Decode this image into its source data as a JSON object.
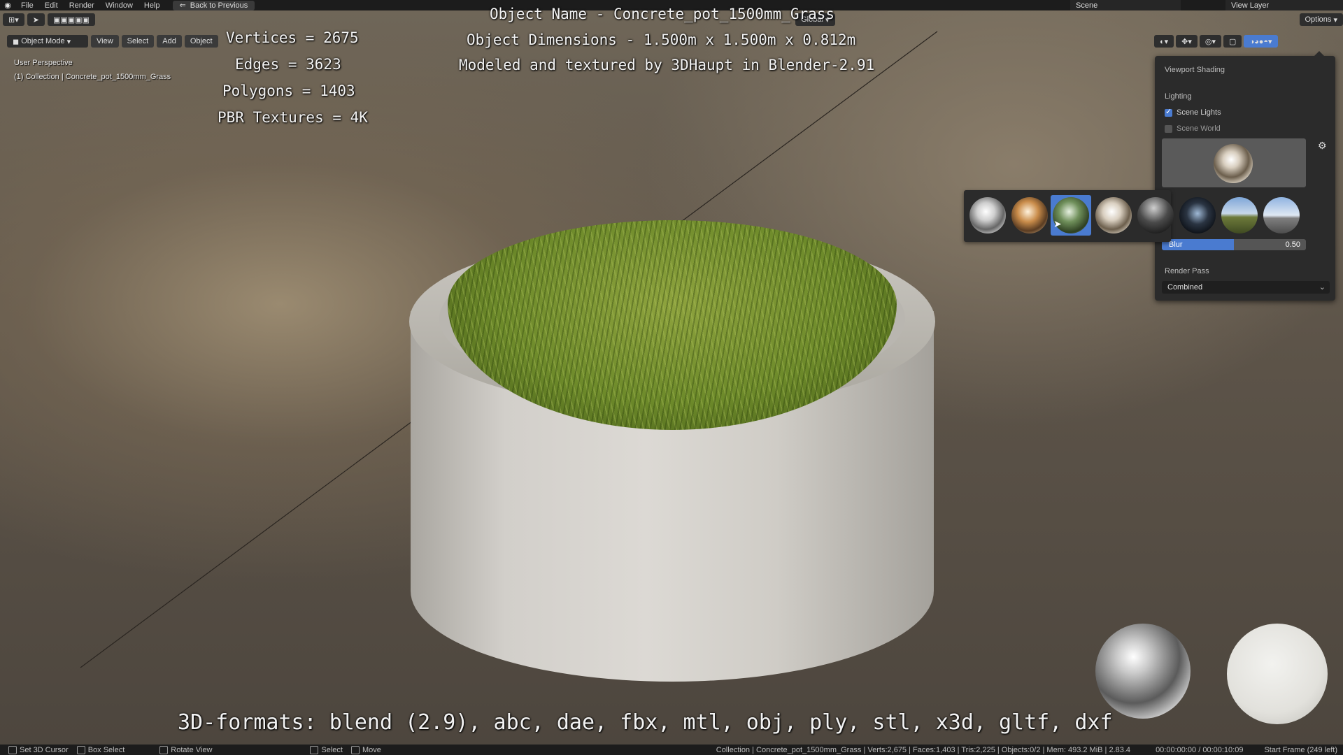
{
  "topbar": {
    "menus": [
      "File",
      "Edit",
      "Render",
      "Window",
      "Help"
    ],
    "back_button": "Back to Previous",
    "scene": "Scene",
    "view_layer": "View Layer"
  },
  "header": {
    "mode": "Object Mode",
    "menus": [
      "View",
      "Select",
      "Add",
      "Object"
    ],
    "orientation": "Global",
    "options": "Options"
  },
  "viewport": {
    "perspective": "User Perspective",
    "collection": "(1) Collection | Concrete_pot_1500mm_Grass",
    "stats": [
      "Vertices = 2675",
      "Edges = 3623",
      "Polygons = 1403",
      "PBR Textures = 4K"
    ],
    "title_lines": [
      "Object Name - Concrete_pot_1500mm_Grass",
      "Object Dimensions -  1.500m x 1.500m x 0.812m",
      "Modeled and textured by 3DHaupt in Blender-2.91"
    ],
    "formats": "3D-formats: blend (2.9), abc, dae, fbx, mtl, obj, ply, stl, x3d, gltf, dxf"
  },
  "shading_panel": {
    "title": "Viewport Shading",
    "lighting_label": "Lighting",
    "scene_lights": "Scene Lights",
    "scene_lights_checked": true,
    "scene_world": "Scene World",
    "scene_world_checked": false,
    "blur_label": "Blur",
    "blur_value": "0.50",
    "blur_fraction": 0.5,
    "render_pass_label": "Render Pass",
    "render_pass_value": "Combined"
  },
  "hdri_picker": {
    "items": [
      "hdri-1",
      "hdri-2",
      "hdri-3",
      "hdri-4",
      "hdri-5",
      "hdri-6",
      "hdri-7",
      "hdri-8"
    ],
    "selected_index": 2
  },
  "statusbar": {
    "left": [
      "Set 3D Cursor",
      "Box Select",
      "Rotate View",
      "Select",
      "Move"
    ],
    "info": "Collection | Concrete_pot_1500mm_Grass | Verts:2,675 | Faces:1,403 | Tris:2,225 | Objects:0/2 | Mem: 493.2 MiB | 2.83.4",
    "time": "00:00:00:00 / 00:00:10:09",
    "frame": "Start Frame (249 left)"
  },
  "colors": {
    "accent": "#4a7bd0",
    "panel": "#2b2b2b",
    "bar": "#1c1c1c"
  }
}
